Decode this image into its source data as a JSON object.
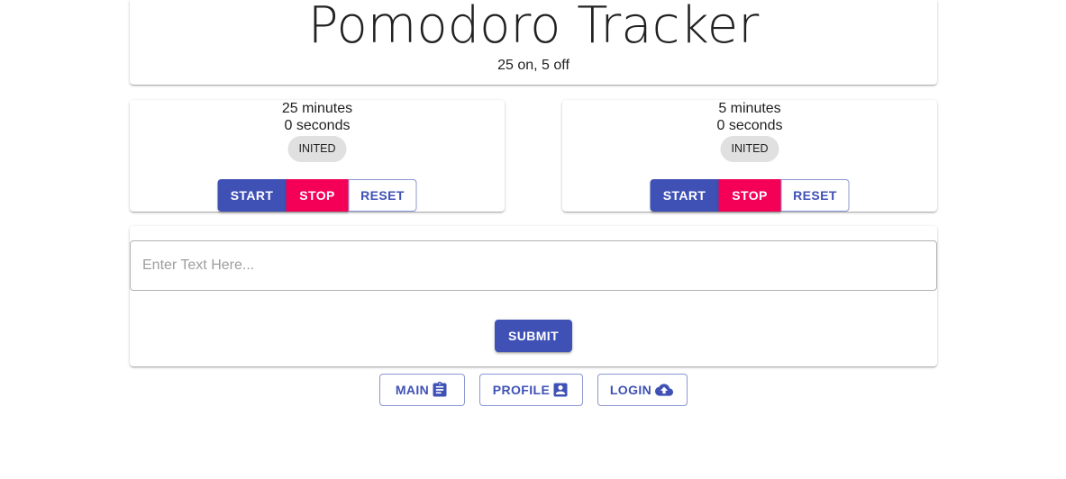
{
  "header": {
    "title": "Pomodoro Tracker",
    "subtitle": "25 on, 5 off"
  },
  "timers": [
    {
      "minutes_text": "25 minutes",
      "seconds_text": "0 seconds",
      "status": "INITED",
      "start_label": "START",
      "stop_label": "STOP",
      "reset_label": "RESET"
    },
    {
      "minutes_text": "5 minutes",
      "seconds_text": "0 seconds",
      "status": "INITED",
      "start_label": "START",
      "stop_label": "STOP",
      "reset_label": "RESET"
    }
  ],
  "form": {
    "input_value": "",
    "input_placeholder": "Enter Text Here...",
    "submit_label": "SUBMIT"
  },
  "nav": {
    "main_label": "MAIN",
    "main_icon": "clipboard-icon",
    "profile_label": "PROFILE",
    "profile_icon": "account-box-icon",
    "login_label": "LOGIN",
    "login_icon": "cloud-upload-icon"
  },
  "colors": {
    "primary": "#3f51b5",
    "secondary": "#f50057",
    "chip": "#e0e0e0"
  }
}
